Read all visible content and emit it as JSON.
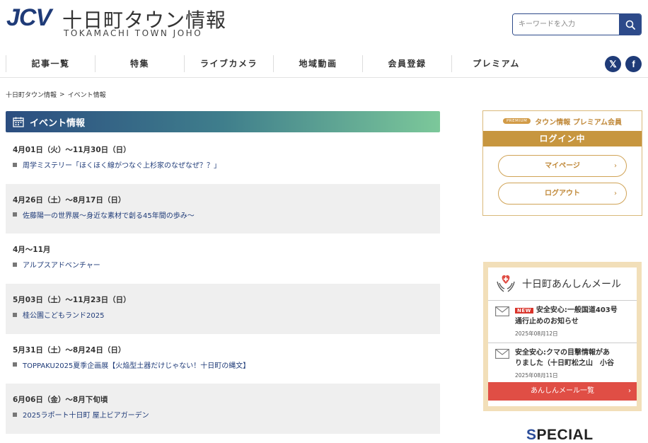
{
  "header": {
    "logo_mark": "JCV",
    "site_title": "十日町タウン情報",
    "site_subtitle": "TOKAMACHI TOWN JOHO",
    "search_placeholder": "キーワードを入力"
  },
  "nav": {
    "items": [
      "記事一覧",
      "特集",
      "ライブカメラ",
      "地域動画",
      "会員登録",
      "プレミアム"
    ],
    "social": [
      "x-icon",
      "facebook-icon"
    ]
  },
  "breadcrumb": {
    "home": "十日町タウン情報",
    "separator": ">",
    "current": "イベント情報"
  },
  "section": {
    "title": "イベント情報"
  },
  "events": [
    {
      "date": "4月01日（火）～11月30日（日）",
      "title": "周学ミステリー「ほくほく線がつなぐ上杉家のなぜなぜ？？」"
    },
    {
      "date": "4月26日（土）～8月17日（日）",
      "title": "佐藤陽一の世界展～身近な素材で創る45年間の歩み～"
    },
    {
      "date": "4月～11月",
      "title": "アルプスアドベンチャー"
    },
    {
      "date": "5月03日（土）～11月23日（日）",
      "title": "桂公園こどもランド2025"
    },
    {
      "date": "5月31日（土）～8月24日（日）",
      "title": "TOPPAKU2025夏季企画展【火焔型土器だけじゃない！十日町の縄文】"
    },
    {
      "date": "6月06日（金）～8月下旬頃",
      "title": "2025ラポート十日町 屋上ビアガーデン"
    }
  ],
  "premium": {
    "pill": "PREMIUM",
    "label": "タウン情報 プレミアム会員",
    "status": "ログイン中",
    "mypage": "マイページ",
    "logout": "ログアウト"
  },
  "mail": {
    "title": "十日町あんしんメール",
    "items": [
      {
        "badge": "NEW",
        "line1": "安全安心:一般国道403号",
        "line2": "通行止めのお知らせ",
        "date": "2025年08月12日"
      },
      {
        "badge": "",
        "line1": "安全安心:クマの目撃情報があ",
        "line2": "りました（十日町松之山　小谷",
        "date": "2025年08月11日"
      }
    ],
    "footer": "あんしんメール一覧"
  },
  "special": {
    "first": "S",
    "rest": "PECIAL"
  },
  "colors": {
    "brand_blue": "#1f3b78",
    "premium_gold": "#c7963f",
    "mail_red": "#e04e45"
  }
}
